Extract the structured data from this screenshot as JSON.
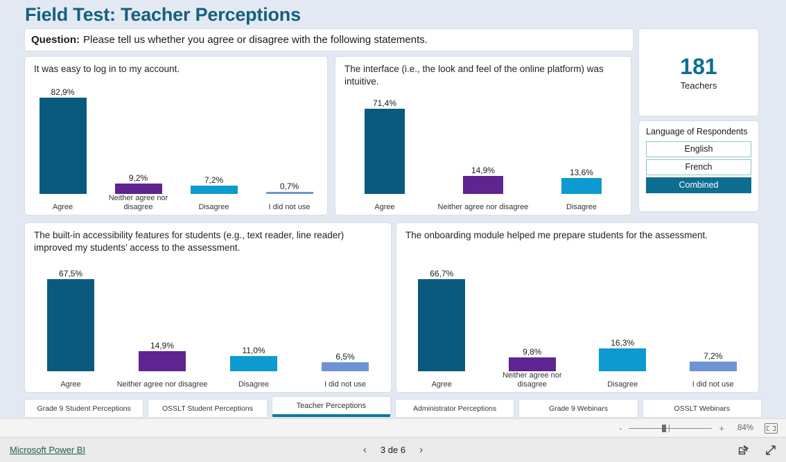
{
  "page": {
    "title": "Field Test: Teacher Perceptions",
    "question_label": "Question:",
    "question_text": "Please tell us whether you agree or disagree with the following statements."
  },
  "kpi": {
    "value": "181",
    "label": "Teachers"
  },
  "slicer": {
    "title": "Language of Respondents",
    "options": [
      {
        "label": "English",
        "selected": false
      },
      {
        "label": "French",
        "selected": false
      },
      {
        "label": "Combined",
        "selected": true
      }
    ]
  },
  "tabs": [
    {
      "label": "Grade 9 Student Perceptions",
      "active": false
    },
    {
      "label": "OSSLT Student Perceptions",
      "active": false
    },
    {
      "label": "Teacher Perceptions",
      "active": true
    },
    {
      "label": "Administrator Perceptions",
      "active": false
    },
    {
      "label": "Grade 9 Webinars",
      "active": false
    },
    {
      "label": "OSSLT Webinars",
      "active": false
    }
  ],
  "zoom_control": {
    "minus": "-",
    "plus": "+",
    "percent": "84%"
  },
  "footer": {
    "brand": "Microsoft Power BI",
    "prev_arrow": "‹",
    "next_arrow": "›",
    "page_label": "3 de 6"
  },
  "colors": {
    "agree": "#0A5A7E",
    "neither": "#5E2490",
    "disagree": "#0C9AD0",
    "not_used": "#6E93D4",
    "accent": "#0E6E91",
    "title": "#15607F",
    "canvas_bg": "#E3E9F2"
  },
  "chart_data": [
    {
      "id": "chart1",
      "type": "bar",
      "title": "It was easy to log in to my account.",
      "categories": [
        "Agree",
        "Neither agree nor disagree",
        "Disagree",
        "I did not use"
      ],
      "values": [
        82.9,
        9.2,
        7.2,
        0.7
      ],
      "labels": [
        "82,9%",
        "9,2%",
        "7,2%",
        "0,7%"
      ],
      "colors": [
        "#0A5A7E",
        "#5E2490",
        "#0C9AD0",
        "#6E93D4"
      ],
      "ylim": [
        0,
        82.9
      ],
      "grid": false,
      "legend": "none"
    },
    {
      "id": "chart2",
      "type": "bar",
      "title": "The interface (i.e., the look and feel of the online platform) was intuitive.",
      "categories": [
        "Agree",
        "Neither agree nor disagree",
        "Disagree"
      ],
      "values": [
        71.4,
        14.9,
        13.6
      ],
      "labels": [
        "71,4%",
        "14,9%",
        "13,6%"
      ],
      "colors": [
        "#0A5A7E",
        "#5E2490",
        "#0C9AD0"
      ],
      "ylim": [
        0,
        71.4
      ],
      "grid": false,
      "legend": "none"
    },
    {
      "id": "chart3",
      "type": "bar",
      "title": "The built-in accessibility features for students (e.g., text reader, line reader) improved my students’ access to the assessment.",
      "categories": [
        "Agree",
        "Neither agree nor disagree",
        "Disagree",
        "I did not use"
      ],
      "values": [
        67.5,
        14.9,
        11.0,
        6.5
      ],
      "labels": [
        "67,5%",
        "14,9%",
        "11,0%",
        "6,5%"
      ],
      "colors": [
        "#0A5A7E",
        "#5E2490",
        "#0C9AD0",
        "#6E93D4"
      ],
      "ylim": [
        0,
        67.5
      ],
      "grid": false,
      "legend": "none"
    },
    {
      "id": "chart4",
      "type": "bar",
      "title": "The onboarding module helped me prepare students for the assessment.",
      "categories": [
        "Agree",
        "Neither agree nor disagree",
        "Disagree",
        "I did not use"
      ],
      "values": [
        66.7,
        9.8,
        16.3,
        7.2
      ],
      "labels": [
        "66,7%",
        "9,8%",
        "16,3%",
        "7,2%"
      ],
      "colors": [
        "#0A5A7E",
        "#5E2490",
        "#0C9AD0",
        "#6E93D4"
      ],
      "ylim": [
        0,
        66.7
      ],
      "grid": false,
      "legend": "none"
    }
  ]
}
